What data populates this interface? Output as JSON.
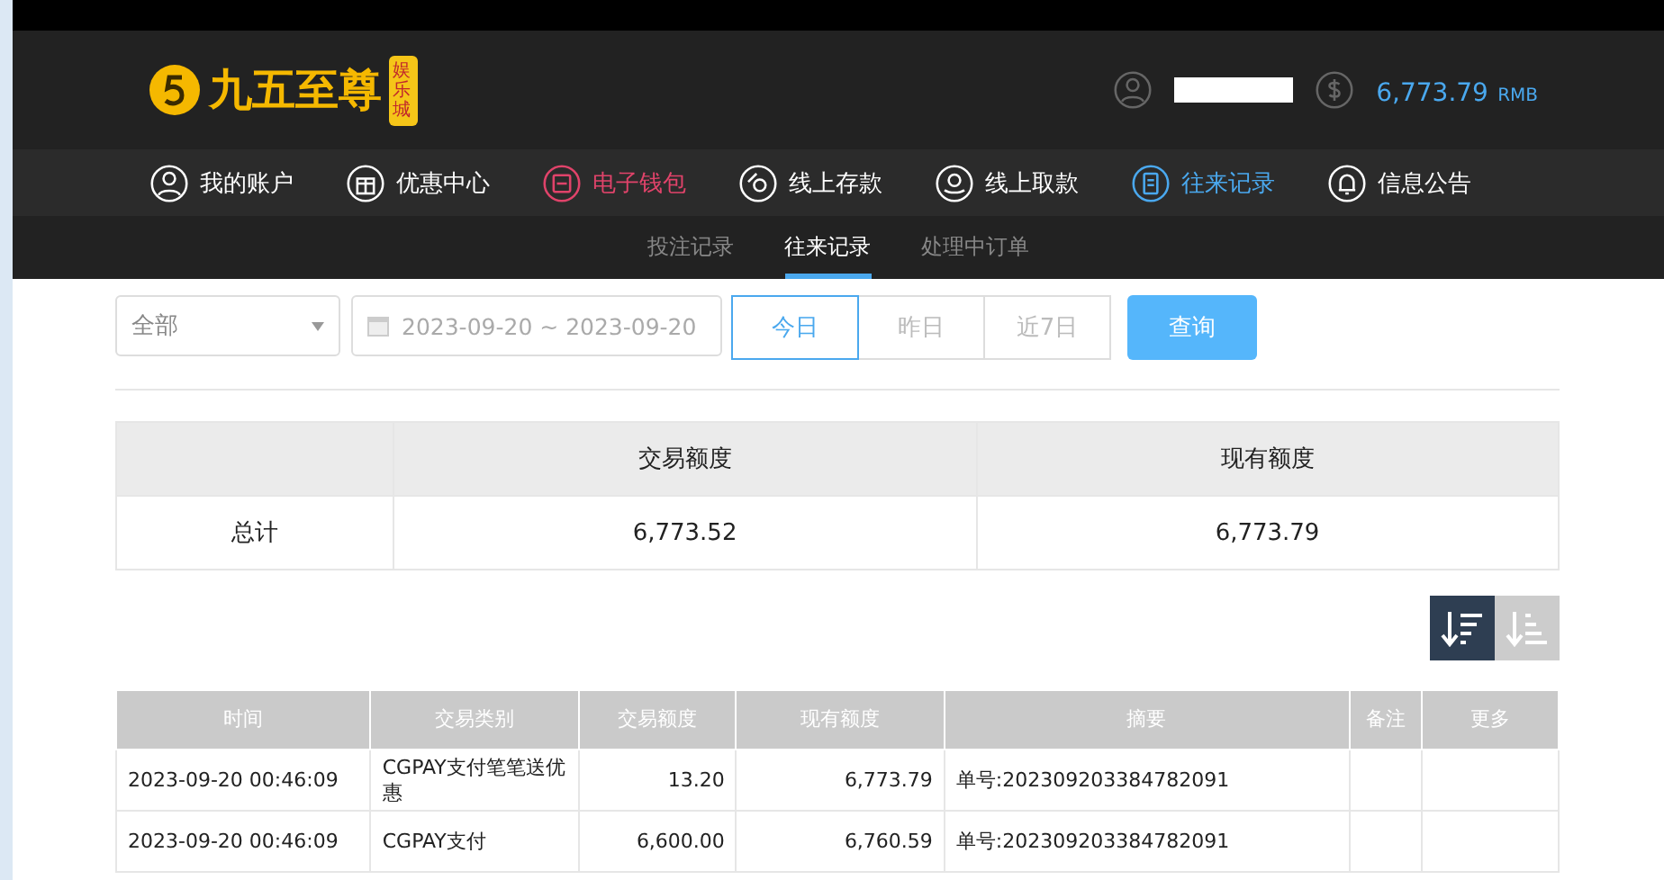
{
  "header": {
    "logo_text": "九五至尊",
    "logo_badge": "娱乐城",
    "balance": "6,773.79",
    "currency": "RMB"
  },
  "nav": [
    {
      "label": "我的账户",
      "kind": "user",
      "selected": false,
      "highlight": false
    },
    {
      "label": "优惠中心",
      "kind": "gift",
      "selected": false,
      "highlight": false
    },
    {
      "label": "电子钱包",
      "kind": "wallet",
      "selected": false,
      "highlight": true
    },
    {
      "label": "线上存款",
      "kind": "deposit",
      "selected": false,
      "highlight": false
    },
    {
      "label": "线上取款",
      "kind": "withdraw",
      "selected": false,
      "highlight": false
    },
    {
      "label": "往来记录",
      "kind": "record",
      "selected": true,
      "highlight": false
    },
    {
      "label": "信息公告",
      "kind": "bell",
      "selected": false,
      "highlight": false
    }
  ],
  "subnav": [
    {
      "label": "投注记录",
      "selected": false
    },
    {
      "label": "往来记录",
      "selected": true
    },
    {
      "label": "处理中订单",
      "selected": false
    }
  ],
  "filters": {
    "type_select": "全部",
    "date_range": "2023-09-20 ~ 2023-09-20",
    "ranges": [
      {
        "label": "今日",
        "selected": true
      },
      {
        "label": "昨日",
        "selected": false
      },
      {
        "label": "近7日",
        "selected": false
      }
    ],
    "query_button": "查询"
  },
  "summary": {
    "columns": [
      "交易额度",
      "现有额度"
    ],
    "row": {
      "label": "总计",
      "values": [
        "6,773.52",
        "6,773.79"
      ]
    }
  },
  "sort_buttons": [
    {
      "kind": "desc",
      "selected": true
    },
    {
      "kind": "asc",
      "selected": false
    }
  ],
  "table": {
    "columns": [
      "时间",
      "交易类别",
      "交易额度",
      "现有额度",
      "摘要",
      "备注",
      "更多"
    ],
    "rows": [
      [
        "2023-09-20 00:46:09",
        "CGPAY支付笔笔送优惠",
        "13.20",
        "6,773.79",
        "单号:202309203384782091",
        "",
        ""
      ],
      [
        "2023-09-20 00:46:09",
        "CGPAY支付",
        "6,600.00",
        "6,760.59",
        "单号:202309203384782091",
        "",
        ""
      ]
    ]
  }
}
